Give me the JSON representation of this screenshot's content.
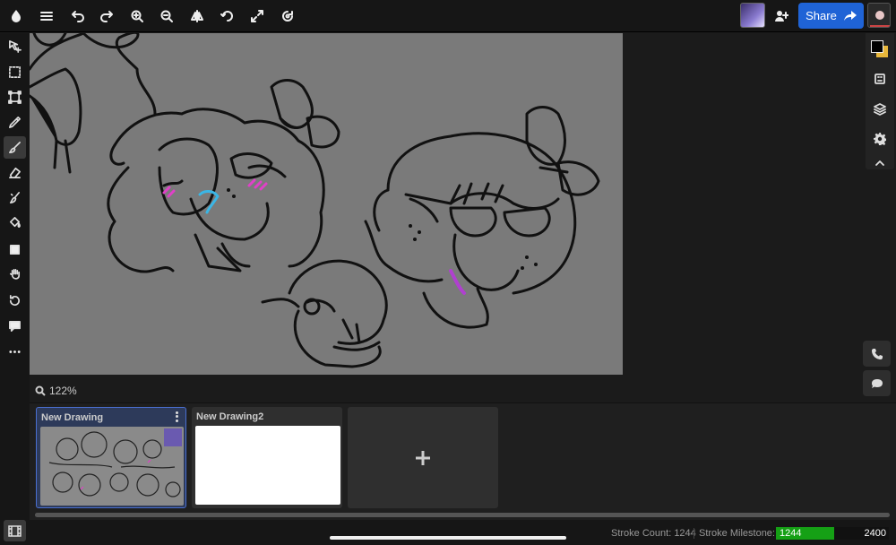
{
  "topbar": {
    "share_label": "Share"
  },
  "canvas": {
    "zoom": "122%"
  },
  "colors": {
    "primary": "#000000",
    "secondary": "#e8b73a",
    "accent": "#1f63d6",
    "milestone_fill": "#15a015"
  },
  "gallery": {
    "drawings": [
      {
        "title": "New Drawing",
        "selected": true
      },
      {
        "title": "New Drawing2",
        "selected": false
      }
    ]
  },
  "status": {
    "stroke_count_label": "Stroke Count: 1244",
    "milestone_label": "Stroke Milestone:",
    "milestone_current": "1244",
    "milestone_target": "2400",
    "milestone_progress": 0.518
  },
  "icons": {
    "toolbar": [
      "move-icon",
      "select-icon",
      "transform-icon",
      "eyedropper-icon",
      "brush-icon",
      "eraser-icon",
      "blend-icon",
      "fill-icon",
      "shape-icon",
      "hand-icon",
      "rotate-icon",
      "text-icon",
      "more-icon"
    ]
  }
}
